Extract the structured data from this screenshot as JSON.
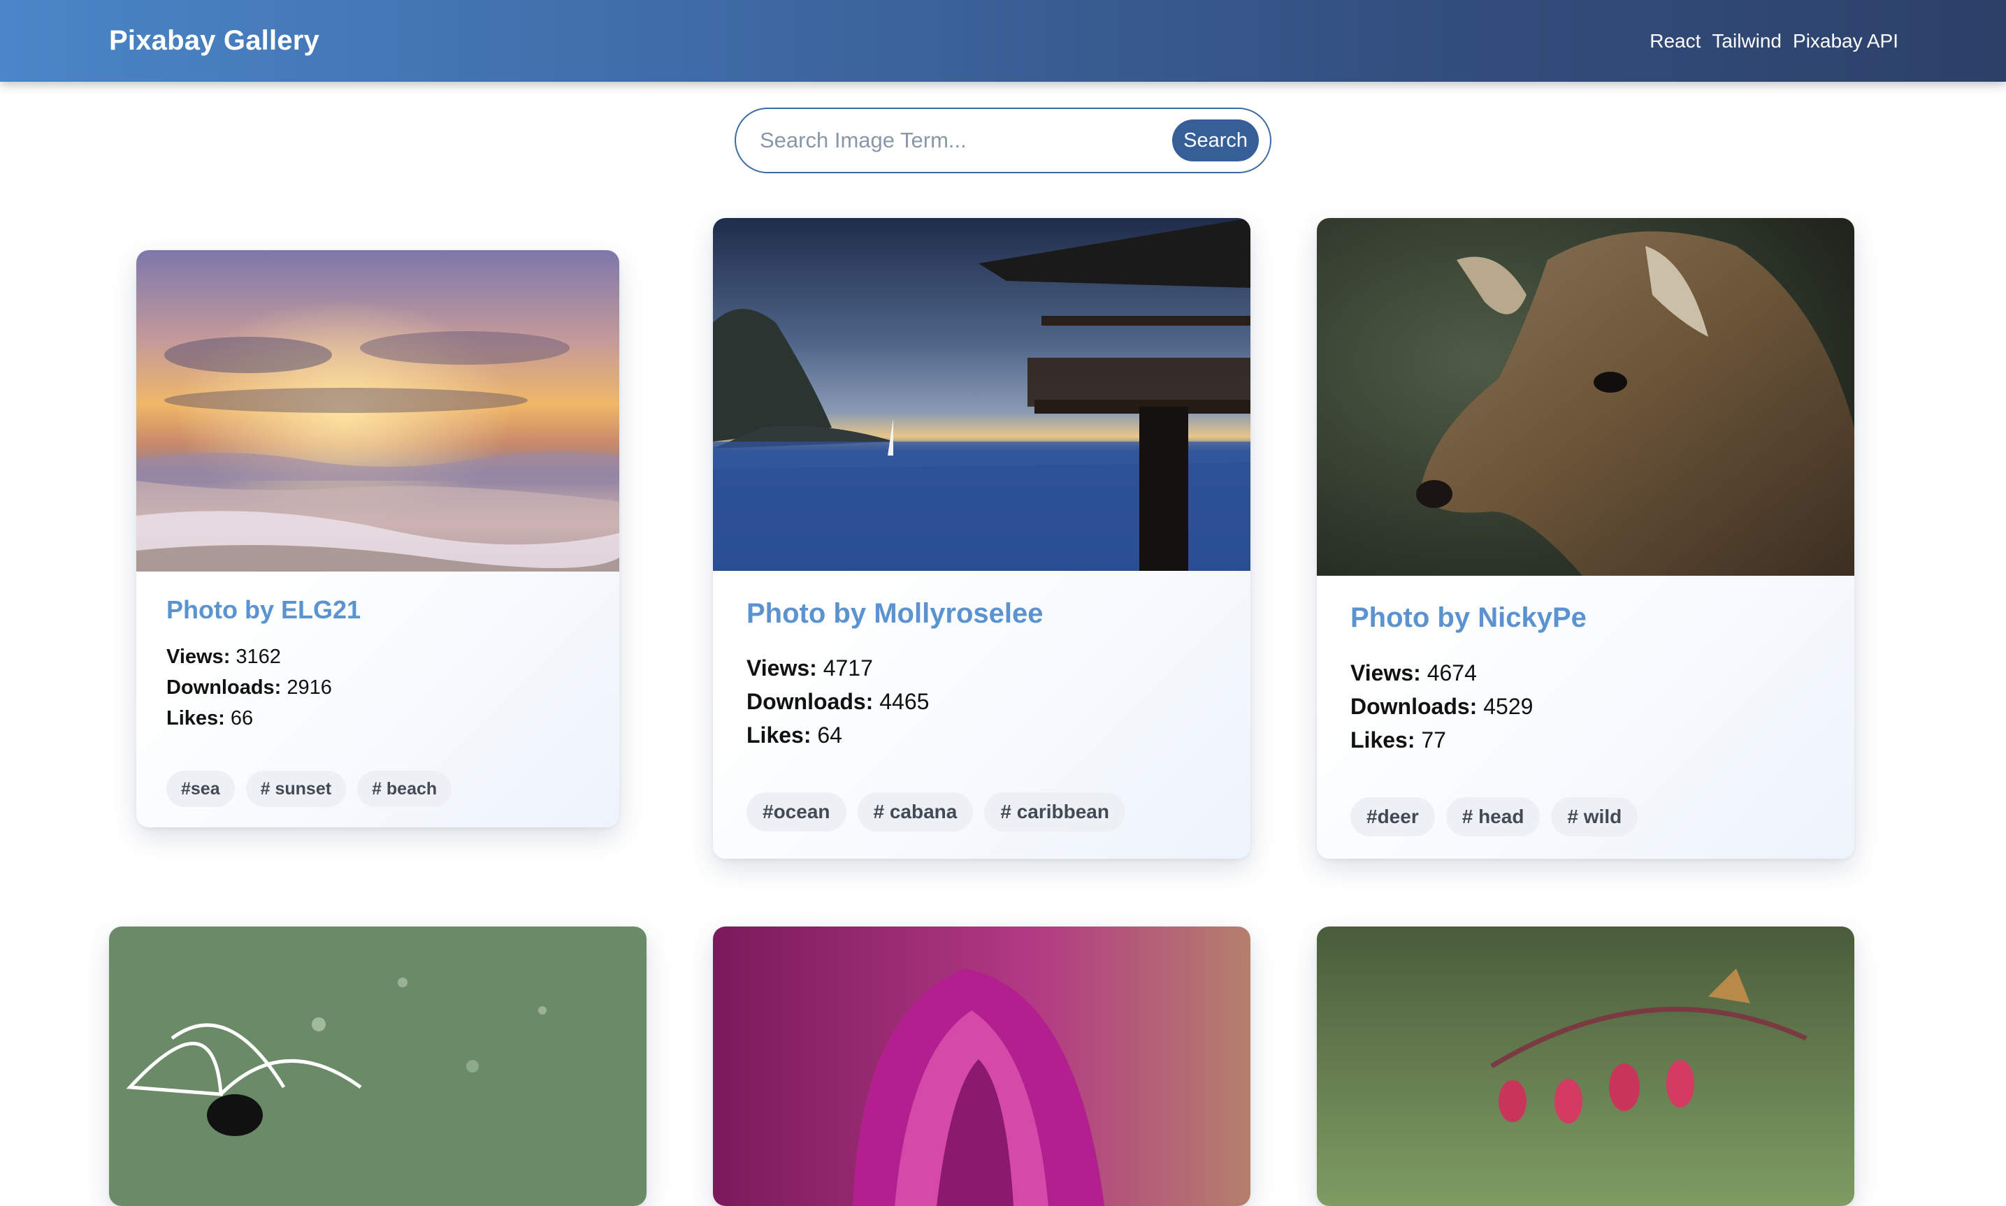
{
  "header": {
    "brand": "Pixabay Gallery",
    "nav": [
      "React",
      "Tailwind",
      "Pixabay API"
    ]
  },
  "search": {
    "placeholder": "Search Image Term...",
    "button_label": "Search"
  },
  "cards": [
    {
      "title": "Photo by ELG21",
      "views_label": "Views:",
      "views": "3162",
      "downloads_label": "Downloads:",
      "downloads": "2916",
      "likes_label": "Likes:",
      "likes": "66",
      "tags": [
        "#sea",
        "# sunset",
        "# beach"
      ]
    },
    {
      "title": "Photo by Mollyroselee",
      "views_label": "Views:",
      "views": "4717",
      "downloads_label": "Downloads:",
      "downloads": "4465",
      "likes_label": "Likes:",
      "likes": "64",
      "tags": [
        "#ocean",
        "# cabana",
        "# caribbean"
      ]
    },
    {
      "title": "Photo by NickyPe",
      "views_label": "Views:",
      "views": "4674",
      "downloads_label": "Downloads:",
      "downloads": "4529",
      "likes_label": "Likes:",
      "likes": "77",
      "tags": [
        "#deer",
        "# head",
        "# wild"
      ]
    }
  ],
  "colors": {
    "header_start": "#4a86c8",
    "header_end": "#2c4168",
    "title_blue": "#5b93d0",
    "search_button": "#365f97",
    "tag_bg": "#edf0f4"
  }
}
